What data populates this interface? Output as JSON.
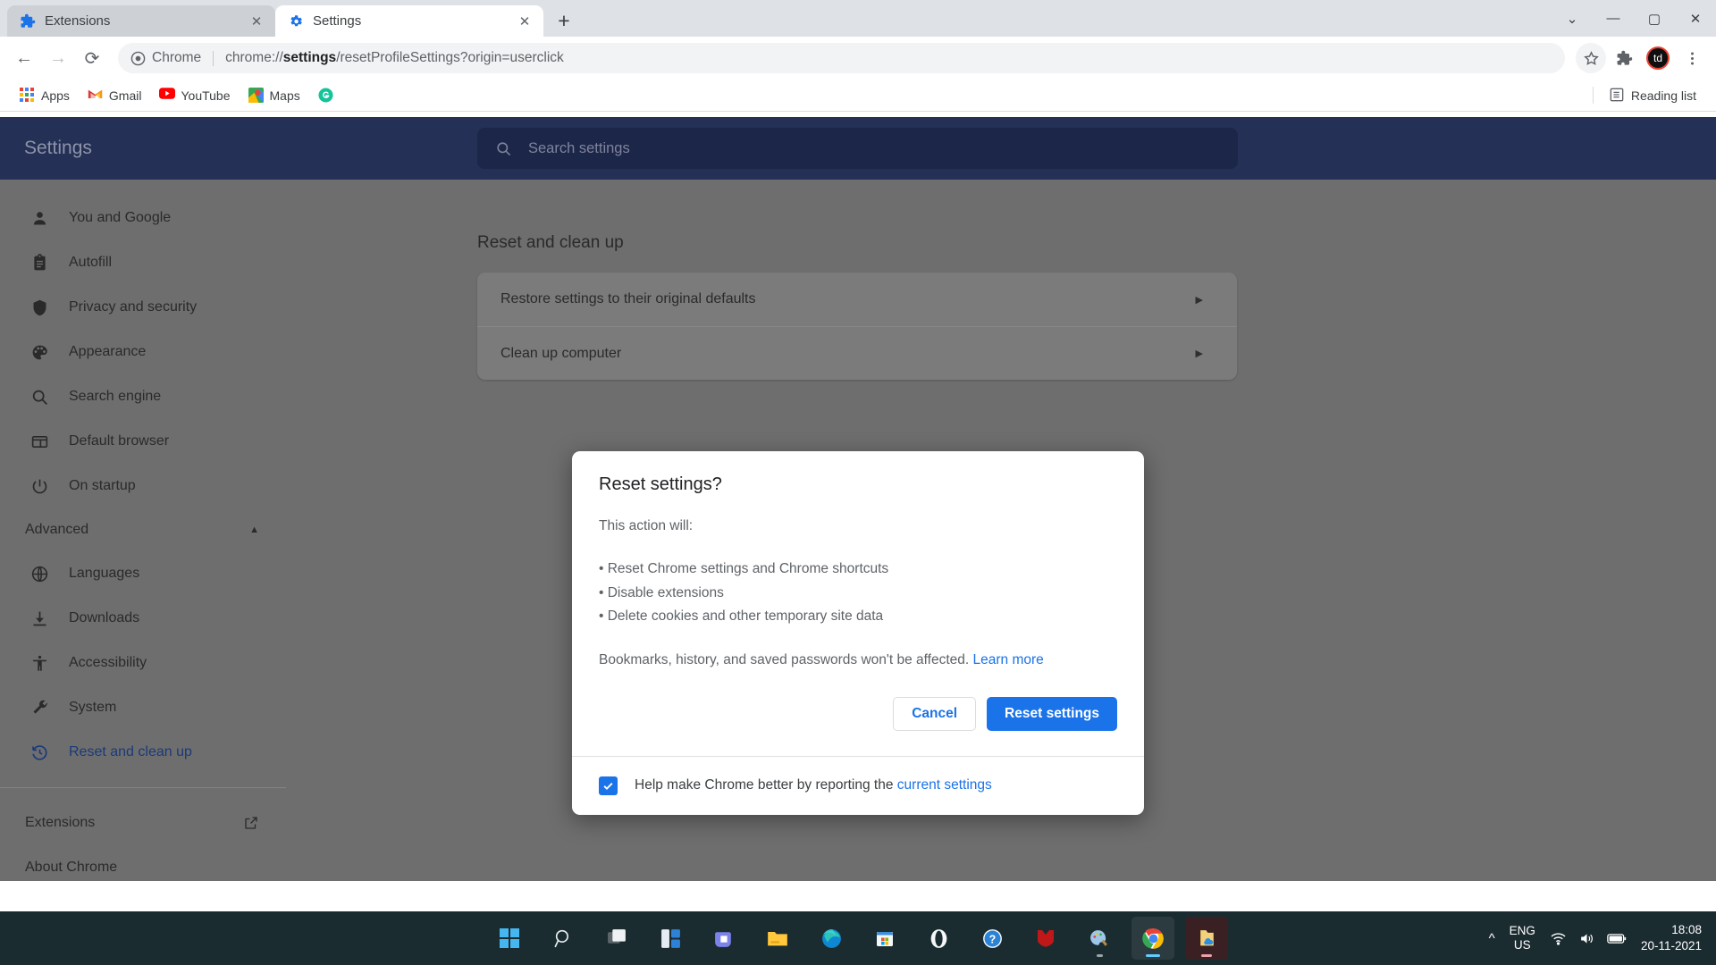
{
  "browser": {
    "tabs": [
      {
        "title": "Extensions",
        "icon": "puzzle-icon",
        "active": false
      },
      {
        "title": "Settings",
        "icon": "gear-icon",
        "active": true
      }
    ],
    "new_tab_label": "+",
    "window_controls": {
      "list": "⌄",
      "minimize": "—",
      "maximize": "▢",
      "close": "✕"
    },
    "toolbar": {
      "back": "←",
      "forward": "→",
      "reload": "⟳",
      "chrome_badge": "Chrome",
      "url_prefix": "chrome://",
      "url_bold": "settings",
      "url_suffix": "/resetProfileSettings?origin=userclick",
      "star_icon": "star-icon",
      "extensions_icon": "puzzle-icon",
      "avatar_initials": "td",
      "menu_icon": "three-dot-menu-icon"
    },
    "bookmarks": [
      {
        "label": "Apps",
        "icon": "apps-grid-icon"
      },
      {
        "label": "Gmail",
        "icon": "gmail-icon"
      },
      {
        "label": "YouTube",
        "icon": "youtube-icon"
      },
      {
        "label": "Maps",
        "icon": "maps-icon"
      },
      {
        "label": "",
        "icon": "grammarly-icon"
      }
    ],
    "reading_list": {
      "label": "Reading list",
      "icon": "reading-list-icon"
    }
  },
  "settings": {
    "header_title": "Settings",
    "search_placeholder": "Search settings",
    "search_value": "",
    "nav": [
      {
        "label": "You and Google",
        "icon": "person-icon"
      },
      {
        "label": "Autofill",
        "icon": "clipboard-icon"
      },
      {
        "label": "Privacy and security",
        "icon": "shield-icon"
      },
      {
        "label": "Appearance",
        "icon": "palette-icon"
      },
      {
        "label": "Search engine",
        "icon": "search-icon"
      },
      {
        "label": "Default browser",
        "icon": "browser-window-icon"
      },
      {
        "label": "On startup",
        "icon": "power-icon"
      }
    ],
    "advanced_group": {
      "label": "Advanced",
      "chevron": "▲"
    },
    "nav_advanced": [
      {
        "label": "Languages",
        "icon": "globe-icon"
      },
      {
        "label": "Downloads",
        "icon": "download-icon"
      },
      {
        "label": "Accessibility",
        "icon": "accessibility-icon"
      },
      {
        "label": "System",
        "icon": "wrench-icon"
      },
      {
        "label": "Reset and clean up",
        "icon": "history-reset-icon",
        "active": true
      }
    ],
    "nav_footer": [
      {
        "label": "Extensions",
        "icon": "external-link-icon"
      },
      {
        "label": "About Chrome",
        "icon": ""
      }
    ],
    "main": {
      "section_title": "Reset and clean up",
      "rows": [
        {
          "label": "Restore settings to their original defaults",
          "arrow": "▶"
        },
        {
          "label": "Clean up computer",
          "arrow": "▶"
        }
      ]
    }
  },
  "dialog": {
    "title": "Reset settings?",
    "lead": "This action will:",
    "bullets": [
      "• Reset Chrome settings and Chrome shortcuts",
      "• Disable extensions",
      "• Delete cookies and other temporary site data"
    ],
    "note_text": "Bookmarks, history, and saved passwords won't be affected.",
    "note_link": "Learn more",
    "cancel_label": "Cancel",
    "confirm_label": "Reset settings",
    "checkbox_checked": true,
    "checkbox_text": "Help make Chrome better by reporting the",
    "checkbox_link": "current settings"
  },
  "taskbar": {
    "apps": [
      {
        "name": "start-icon"
      },
      {
        "name": "search-icon"
      },
      {
        "name": "task-view-icon"
      },
      {
        "name": "widgets-icon"
      },
      {
        "name": "teams-icon"
      },
      {
        "name": "file-explorer-icon"
      },
      {
        "name": "edge-icon"
      },
      {
        "name": "microsoft-store-icon"
      },
      {
        "name": "opera-icon"
      },
      {
        "name": "help-icon"
      },
      {
        "name": "mcafee-icon"
      },
      {
        "name": "paint-icon"
      },
      {
        "name": "chrome-icon"
      },
      {
        "name": "folder-onedrive-icon"
      }
    ],
    "tray": {
      "chevron": "^",
      "lang_line1": "ENG",
      "lang_line2": "US",
      "wifi_icon": "wifi-icon",
      "volume_icon": "volume-icon",
      "battery_icon": "battery-icon",
      "time": "18:08",
      "date": "20-11-2021"
    }
  },
  "colors": {
    "accent": "#1a73e8",
    "header": "#253057",
    "taskbar": "#1b2c31"
  }
}
